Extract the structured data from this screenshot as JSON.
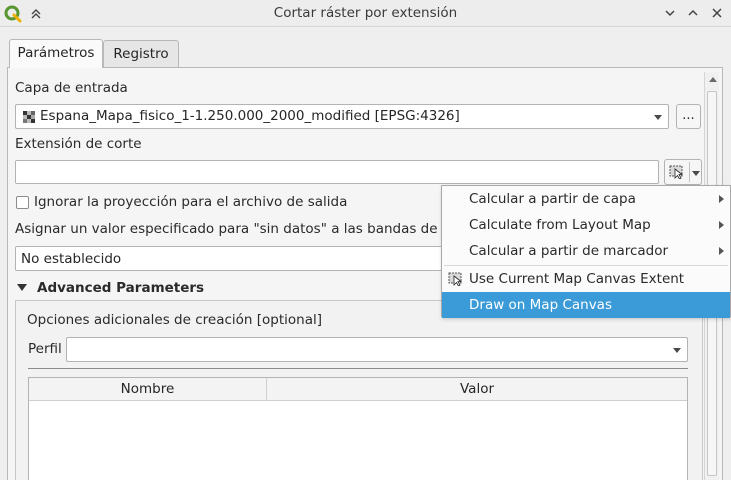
{
  "window": {
    "title": "Cortar ráster por extensión"
  },
  "tabs": [
    {
      "label": "Parámetros",
      "active": true
    },
    {
      "label": "Registro",
      "active": false
    }
  ],
  "form": {
    "input_layer_label": "Capa de entrada",
    "input_layer_value": "Espana_Mapa_fisico_1-1.250.000_2000_modified [EPSG:4326]",
    "browse_label": "...",
    "extent_label": "Extensión de corte",
    "extent_value": "",
    "ignore_projection_label": "Ignorar la proyección para el archivo de salida",
    "ignore_projection_checked": false,
    "nodata_label": "Asignar un valor especificado para \"sin datos\" a las bandas de salida [o",
    "nodata_value": "No establecido",
    "advanced_label": "Advanced Parameters",
    "creation_options_label": "Opciones adicionales de creación [optional]",
    "profile_label": "Perfil",
    "profile_value": "",
    "table_headers": [
      "Nombre",
      "Valor"
    ]
  },
  "menu": {
    "items": [
      {
        "label": "Calcular a partir de capa",
        "submenu": true,
        "icon": ""
      },
      {
        "label": "Calculate from Layout Map",
        "submenu": true,
        "icon": ""
      },
      {
        "label": "Calcular a partir de marcador",
        "submenu": true,
        "icon": ""
      },
      {
        "label": "Use Current Map Canvas Extent",
        "submenu": false,
        "icon": "map-extent-icon"
      },
      {
        "label": "Draw on Map Canvas",
        "submenu": false,
        "icon": "",
        "highlighted": true
      }
    ]
  },
  "colors": {
    "highlight": "#3a9bd8",
    "qgis_green": "#589632",
    "qgis_yellow": "#eeb000"
  }
}
